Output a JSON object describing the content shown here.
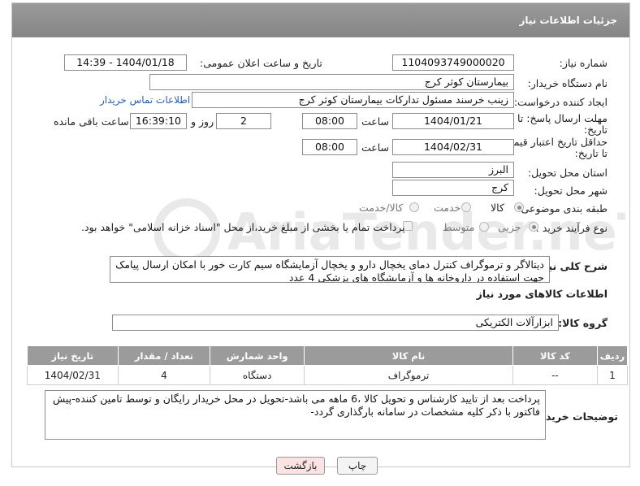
{
  "header": {
    "title": "جزئیات اطلاعات نیاز"
  },
  "fields": {
    "need_number_label": "شماره نیاز:",
    "need_number": "1104093749000020",
    "announce_label": "تاریخ و ساعت اعلان عمومی:",
    "announce_value": "1404/01/18 - 14:39",
    "buyer_org_label": "نام دستگاه خریدار:",
    "buyer_org": "بیمارستان کوثر کرج",
    "creator_label": "ایجاد کننده درخواست:",
    "creator": "زینب خرسند مسئول تداركات بیمارستان كوثر كرج",
    "contact_link": "اطلاعات تماس خریدار",
    "deadline_label_1": "مهلت ارسال پاسخ: تا",
    "deadline_label_2": "تاریخ:",
    "deadline_date": "1404/01/21",
    "time_label": "ساعت",
    "deadline_time": "08:00",
    "days_value": "2",
    "days_label": "روز و",
    "remaining_time": "16:39:10",
    "remaining_label": "ساعت باقی مانده",
    "validity_label_1": "حداقل تاریخ اعتبار قیمت:",
    "validity_label_2": "تا تاریخ:",
    "validity_date": "1404/02/31",
    "validity_time": "08:00",
    "province_label": "استان محل تحویل:",
    "province": "البرز",
    "city_label": "شهر محل تحویل:",
    "city": "کرج",
    "category_label": "طبقه بندی موضوعی:",
    "category_options": [
      "کالا",
      "خدمت",
      "کالا/خدمت"
    ],
    "category_selected": "کالا",
    "process_label": "نوع فرآیند خرید :",
    "process_options": [
      "جزیی",
      "متوسط"
    ],
    "process_selected": "جزیی",
    "payment_note": "پرداخت تمام یا بخشی از مبلغ خرید،از محل \"اسناد خزانه اسلامی\" خواهد بود.",
    "summary_label": "شرح کلی نیاز:",
    "summary_text": "دیتالاگر و ترموگراف کنترل دمای یخچال دارو و یخچال آزمایشگاه سیم کارت خور با امکان ارسال پیامک جهت استفاده در داروخانه ها و آزمایشگاه های پزشکی 4 عدد",
    "goods_info_title": "اطلاعات کالاهای مورد نیاز",
    "goods_group_label": "گروه کالا:",
    "goods_group": "ابزارآلات الکتریکی"
  },
  "table": {
    "headers": [
      "ردیف",
      "کد کالا",
      "نام کالا",
      "واحد شمارش",
      "تعداد / مقدار",
      "تاریخ نیاز"
    ],
    "rows": [
      [
        "1",
        "--",
        "ترموگراف",
        "دستگاه",
        "4",
        "1404/02/31"
      ]
    ]
  },
  "buyer_notes_label": "توضیحات خریدار:",
  "buyer_notes": "پرداخت بعد از تایید کارشناس و تحویل کالا ،6 ماهه می باشد-تحویل در محل خریدار رایگان و توسط تامین کننده-پیش فاکتور با ذکر کلیه مشخصات در سامانه بارگذاری گردد-",
  "buttons": {
    "print": "چاپ",
    "back": "بازگشت"
  },
  "watermark_text": "AriaTender.neT",
  "colors": {
    "header_bg": "#8d8d8d",
    "link": "#2b5fb0",
    "back_btn_bg": "#fbe3e3",
    "table_header": "#9b9b9b"
  }
}
